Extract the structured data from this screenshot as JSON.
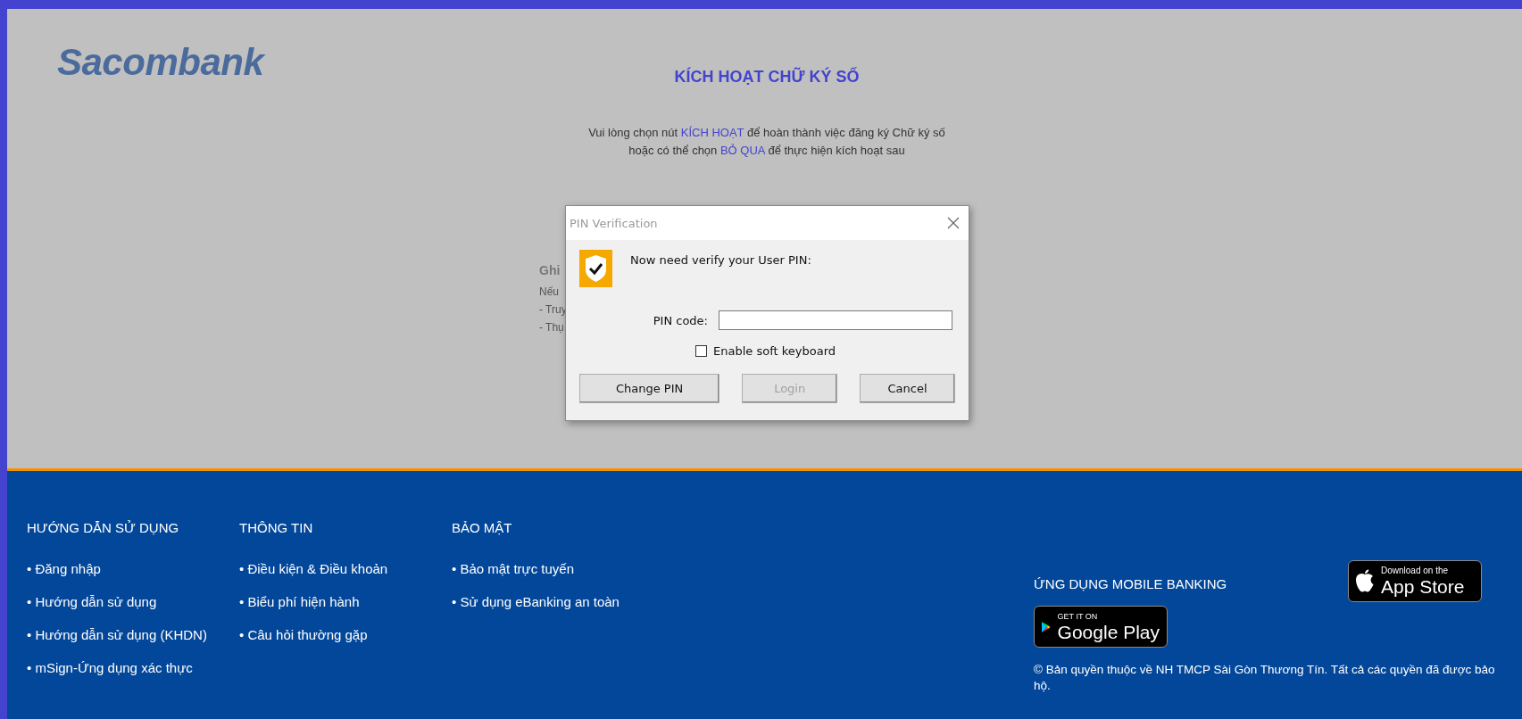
{
  "logo": "Sacombank",
  "title": "KÍCH HOẠT CHỮ KÝ SỐ",
  "instructions": [
    [
      {
        "text": "Vui lòng chọn nút ",
        "highlight": false
      },
      {
        "text": "KÍCH HOẠT",
        "highlight": true
      },
      {
        "text": " để hoàn thành việc đăng ký Chữ ký số",
        "highlight": false
      }
    ],
    [
      {
        "text": "hoặc có thể chọn ",
        "highlight": false
      },
      {
        "text": "BỎ QUA",
        "highlight": true
      },
      {
        "text": " để thực hiện kích hoạt sau",
        "highlight": false
      }
    ]
  ],
  "note": {
    "heading": "Ghi",
    "lines": [
      "Nếu",
      "- Truy",
      "- Thụ"
    ]
  },
  "dialog": {
    "title": "PIN Verification",
    "message": "Now need verify your User PIN:",
    "pin_label": "PIN code:",
    "checkbox": {
      "label": "Enable soft keyboard",
      "checked": false
    },
    "buttons": [
      {
        "label": "Change PIN",
        "disabled": false
      },
      {
        "label": "Login",
        "disabled": true
      },
      {
        "label": "Cancel",
        "disabled": false
      }
    ]
  },
  "footer": {
    "columns": [
      {
        "heading": "HƯỚNG DẪN SỬ DỤNG",
        "items": [
          "• Đăng nhập",
          "• Hướng dẫn sử dụng",
          "• Hướng dẫn sử dụng (KHDN)",
          "• mSign-Ứng dụng xác thực"
        ]
      },
      {
        "heading": "THÔNG TIN",
        "items": [
          "• Điều kiện & Điều khoản",
          "• Biểu phí hiện hành",
          "• Câu hỏi thường gặp"
        ]
      },
      {
        "heading": "BẢO MẬT",
        "items": [
          "• Bảo mật trực tuyến",
          "• Sử dụng eBanking an toàn"
        ]
      }
    ],
    "mobile_heading": "ỨNG DỤNG MOBILE BANKING",
    "app_store": {
      "small": "Download on the",
      "big": "App Store"
    },
    "google_play": {
      "small": "GET IT ON",
      "big": "Google Play"
    },
    "copyright": "© Bản quyền thuộc về NH TMCP Sài Gòn Thương Tín. Tất cả các quyền đã được bảo hộ."
  }
}
